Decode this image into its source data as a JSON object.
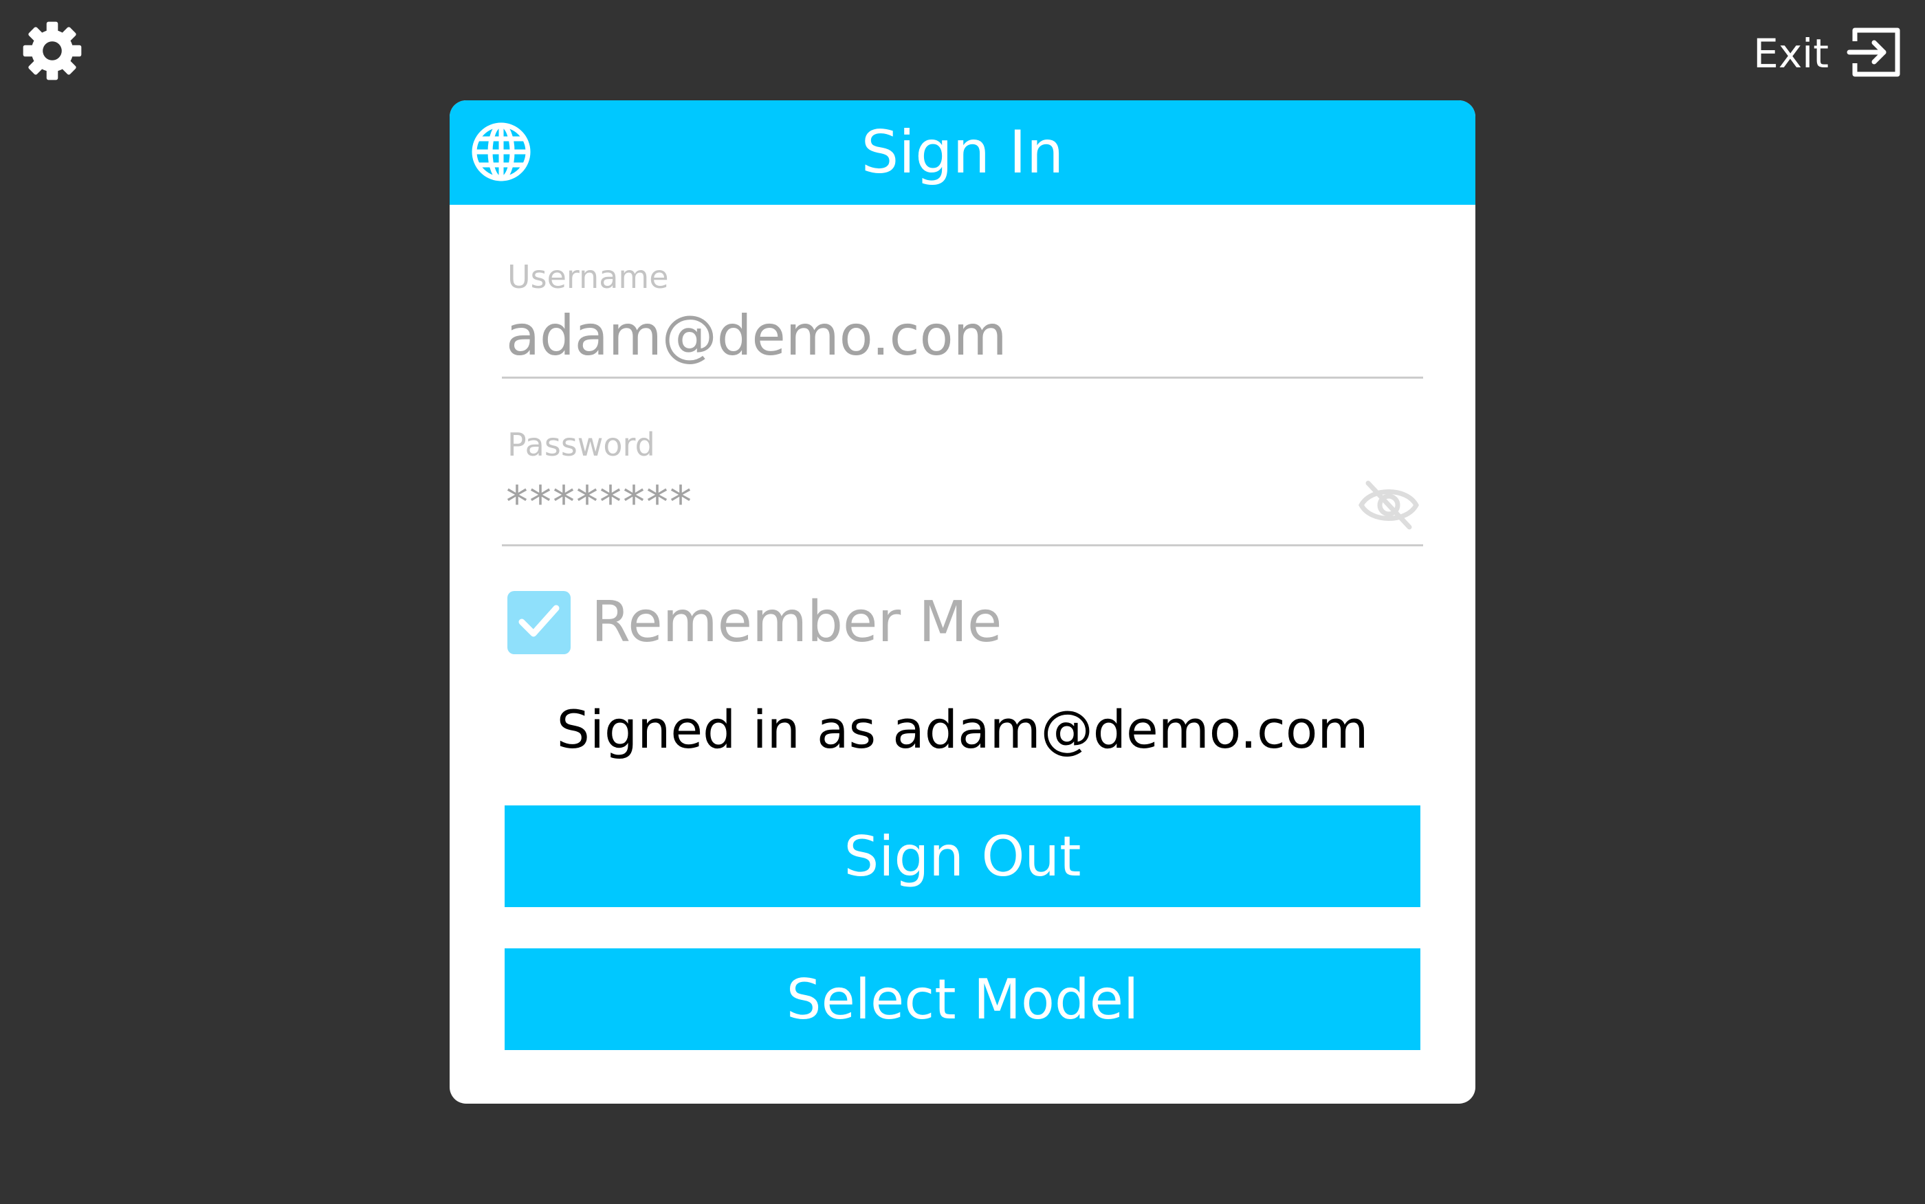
{
  "header": {
    "exit_label": "Exit"
  },
  "icons": {
    "settings": "gear-icon",
    "exit": "exit-icon",
    "language": "globe-icon",
    "password_visibility": "eye-off-icon",
    "checkbox": "check-icon"
  },
  "dialog": {
    "title": "Sign In",
    "username": {
      "label": "Username",
      "value": "adam@demo.com"
    },
    "password": {
      "label": "Password",
      "value": "********"
    },
    "remember_me": {
      "label": "Remember Me",
      "checked": true
    },
    "status": "Signed in as adam@demo.com",
    "sign_out_label": "Sign Out",
    "select_model_label": "Select Model"
  },
  "colors": {
    "background": "#333333",
    "accent": "#00c8ff",
    "card": "#ffffff",
    "checkbox_fill": "#8fe0fb"
  }
}
